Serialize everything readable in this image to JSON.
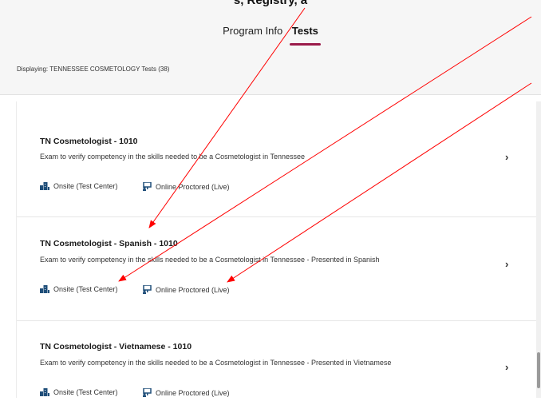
{
  "header": {
    "cut_text": "s, Registry, a",
    "tabs": [
      {
        "label": "Program Info",
        "active": false
      },
      {
        "label": "Tests",
        "active": true
      }
    ],
    "displaying": "Displaying: TENNESSEE COSMETOLOGY Tests (38)"
  },
  "tests": [
    {
      "title": "TN Cosmetologist - 1010",
      "description": "Exam to verify competency in the skills needed to be a Cosmetologist in Tennessee",
      "modes": [
        "Onsite (Test Center)",
        "Online Proctored (Live)"
      ]
    },
    {
      "title": "TN Cosmetologist - Spanish - 1010",
      "description": "Exam to verify competency in the skills needed to be a Cosmetologist in Tennessee - Presented in Spanish",
      "modes": [
        "Onsite (Test Center)",
        "Online Proctored (Live)"
      ]
    },
    {
      "title": "TN Cosmetologist - Vietnamese - 1010",
      "description": "Exam to verify competency in the skills needed to be a Cosmetologist in Tennessee - Presented in Vietnamese",
      "modes": [
        "Onsite (Test Center)",
        "Online Proctored (Live)"
      ]
    }
  ],
  "icons": {
    "chevron": "›",
    "onsite": "building-icon",
    "online": "proctor-monitor-icon"
  },
  "colors": {
    "tab_underline": "#9b1b4a",
    "annotation_arrow": "#ff0000",
    "icon": "#1f4e79"
  }
}
